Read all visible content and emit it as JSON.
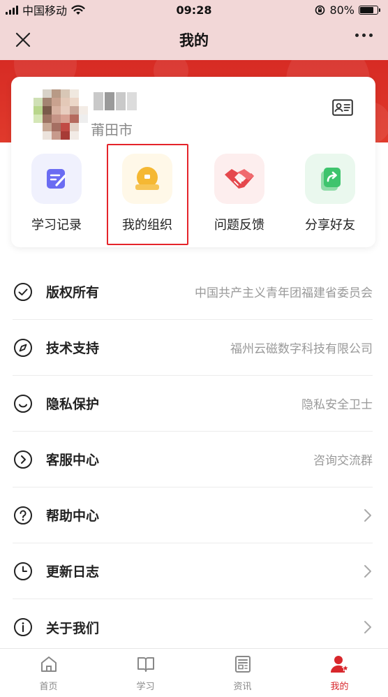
{
  "status_bar": {
    "carrier": "中国移动",
    "time": "09:28",
    "battery": "80%"
  },
  "nav": {
    "title": "我的"
  },
  "profile": {
    "city": "莆田市"
  },
  "quick_actions": [
    {
      "label": "学习记录",
      "icon": "edit-note-icon",
      "color": "#6a6cf2"
    },
    {
      "label": "我的组织",
      "icon": "organization-icon",
      "color": "#f5b833"
    },
    {
      "label": "问题反馈",
      "icon": "handshake-icon",
      "color": "#e5484d"
    },
    {
      "label": "分享好友",
      "icon": "share-icon",
      "color": "#3ec46d"
    }
  ],
  "menu": [
    {
      "label": "版权所有",
      "value": "中国共产主义青年团福建省委员会",
      "icon": "check-circle-icon"
    },
    {
      "label": "技术支持",
      "value": "福州云磁数字科技有限公司",
      "icon": "compass-icon"
    },
    {
      "label": "隐私保护",
      "value": "隐私安全卫士",
      "icon": "smile-icon"
    },
    {
      "label": "客服中心",
      "value": "咨询交流群",
      "icon": "arrow-circle-icon"
    },
    {
      "label": "帮助中心",
      "value": "",
      "icon": "help-circle-icon"
    },
    {
      "label": "更新日志",
      "value": "",
      "icon": "clock-icon"
    },
    {
      "label": "关于我们",
      "value": "",
      "icon": "info-circle-icon"
    }
  ],
  "tabs": [
    {
      "label": "首页",
      "icon": "home-icon"
    },
    {
      "label": "学习",
      "icon": "book-icon"
    },
    {
      "label": "资讯",
      "icon": "news-icon"
    },
    {
      "label": "我的",
      "icon": "profile-icon",
      "active": true
    }
  ],
  "colors": {
    "brand_red": "#d72b24",
    "active_tab": "#d8272c"
  }
}
